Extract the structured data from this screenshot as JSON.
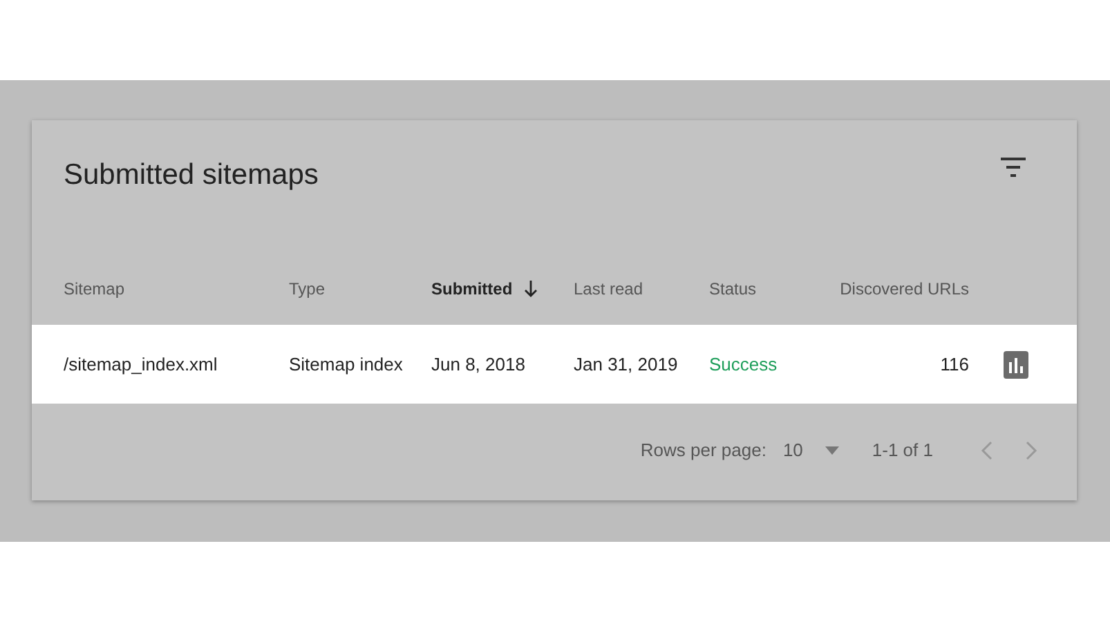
{
  "card": {
    "title": "Submitted sitemaps"
  },
  "table": {
    "columns": [
      {
        "label": "Sitemap",
        "sorted": false
      },
      {
        "label": "Type",
        "sorted": false
      },
      {
        "label": "Submitted",
        "sorted": true
      },
      {
        "label": "Last read",
        "sorted": false
      },
      {
        "label": "Status",
        "sorted": false
      },
      {
        "label": "Discovered URLs",
        "sorted": false
      }
    ],
    "rows": [
      {
        "cells": [
          "/sitemap_index.xml",
          "Sitemap index",
          "Jun 8, 2018",
          "Jan 31, 2019",
          "Success",
          "116"
        ],
        "color": "#1e9e5a"
      }
    ]
  },
  "pagination": {
    "rows_label": "Rows per page:",
    "rows_value": "10",
    "range": "1-1 of 1",
    "prev_disabled": true,
    "next_disabled": true
  }
}
